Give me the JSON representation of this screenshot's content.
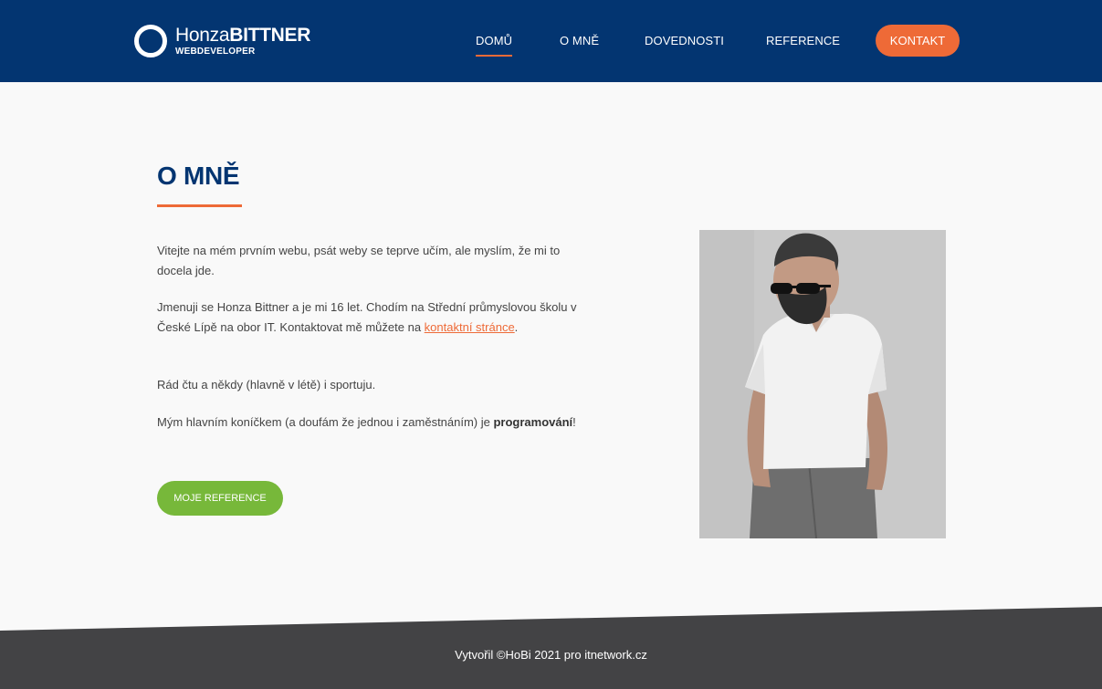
{
  "header": {
    "logo": {
      "name_first": "Honza",
      "name_last": "BITTNER",
      "subtitle": "WEBDEVELOPER"
    },
    "nav": [
      {
        "label": "DOMŮ",
        "active": true
      },
      {
        "label": "O MNĚ",
        "active": false
      },
      {
        "label": "DOVEDNOSTI",
        "active": false
      },
      {
        "label": "REFERENCE",
        "active": false
      }
    ],
    "cta_label": "KONTAKT"
  },
  "main": {
    "title": "O MNĚ",
    "p1": "Vitejte na mém prvním webu, psát weby se teprve učím, ale myslím, že mi to docela jde.",
    "p2_text": "Jmenuji se Honza Bittner a je mi 16 let. Chodím na Střední průmyslovou školu v České Lípě na obor IT. Kontaktovat mě můžete na ",
    "p2_link": "kontaktní stránce",
    "p2_end": ".",
    "p3": "Rád čtu a někdy (hlavně v létě) i sportuju.",
    "p4_text": "Mým hlavním koníčkem (a doufám že jednou i zaměstnáním) je ",
    "p4_bold": "programování",
    "p4_end": "!",
    "button_label": "MOJE REFERENCE"
  },
  "footer": {
    "text": "Vytvořil ©HoBi 2021 pro itnetwork.cz"
  },
  "colors": {
    "header_bg": "#033571",
    "accent": "#ee6a37",
    "button_green": "#77b83a",
    "footer_bg": "#434345",
    "page_bg": "#f9f9f9"
  }
}
